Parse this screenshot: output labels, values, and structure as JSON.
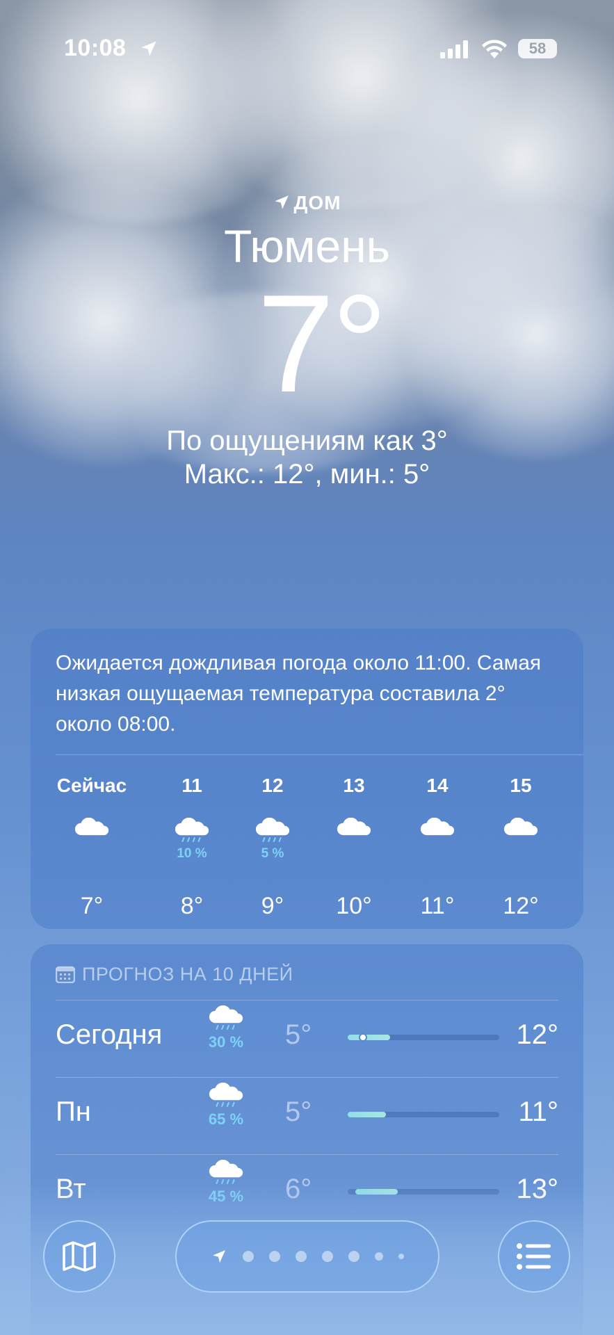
{
  "status_bar": {
    "time": "10:08",
    "battery": "58"
  },
  "header": {
    "home_label": "ДОМ",
    "city": "Тюмень",
    "temperature": "7°",
    "feels_like": "По ощущениям как 3°",
    "min_max": "Макс.: 12°, мин.: 5°"
  },
  "hourly": {
    "summary": "Ожидается дождливая погода около 11:00. Самая низкая ощущаемая температура составила 2° около 08:00.",
    "hours": [
      {
        "label": "Сейчас",
        "icon": "cloud-icon",
        "precip": "",
        "temp": "7°"
      },
      {
        "label": "11",
        "icon": "cloud-rain-icon",
        "precip": "10 %",
        "temp": "8°"
      },
      {
        "label": "12",
        "icon": "cloud-rain-icon",
        "precip": "5 %",
        "temp": "9°"
      },
      {
        "label": "13",
        "icon": "cloud-icon",
        "precip": "",
        "temp": "10°"
      },
      {
        "label": "14",
        "icon": "cloud-icon",
        "precip": "",
        "temp": "11°"
      },
      {
        "label": "15",
        "icon": "cloud-icon",
        "precip": "",
        "temp": "12°"
      }
    ]
  },
  "forecast": {
    "title": "ПРОГНОЗ НА 10 ДНЕЙ",
    "days": [
      {
        "name": "Сегодня",
        "icon": "cloud-rain-icon",
        "precip": "30 %",
        "min": "5°",
        "max": "12°",
        "range_start": 0.0,
        "range_end": 0.28,
        "current": 0.1
      },
      {
        "name": "Пн",
        "icon": "cloud-rain-icon",
        "precip": "65 %",
        "min": "5°",
        "max": "11°",
        "range_start": 0.0,
        "range_end": 0.25
      },
      {
        "name": "Вт",
        "icon": "cloud-rain-icon",
        "precip": "45 %",
        "min": "6°",
        "max": "13°",
        "range_start": 0.05,
        "range_end": 0.33
      }
    ]
  },
  "bottom_bar": {
    "map_icon": "map-icon",
    "list_icon": "list-icon",
    "pages": 7
  },
  "colors": {
    "precip": "#7dd3f7",
    "bar": "#a8e6e0"
  }
}
